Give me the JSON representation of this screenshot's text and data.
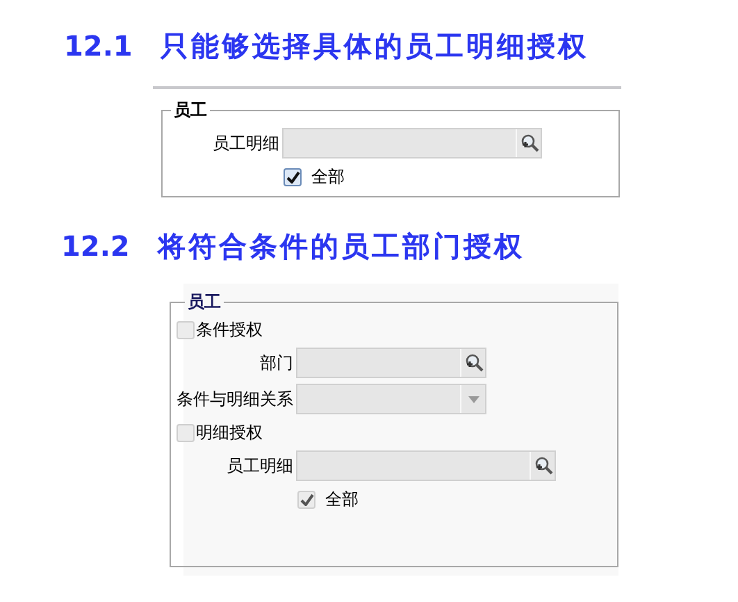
{
  "sections": [
    {
      "number": "12.1",
      "title": "只能够选择具体的员工明细授权",
      "panel": {
        "legend": "员工",
        "rows": [
          {
            "kind": "lookup_field",
            "label": "员工明细",
            "wide": true
          },
          {
            "kind": "checkbox",
            "label": "全部",
            "checked": true,
            "disabled": false
          }
        ]
      }
    },
    {
      "number": "12.2",
      "title": "将符合条件的员工部门授权",
      "panel": {
        "legend": "员工",
        "rows": [
          {
            "kind": "group_checkbox",
            "label": "条件授权",
            "checked": false,
            "disabled": true
          },
          {
            "kind": "lookup_field",
            "label": "部门",
            "wide": false
          },
          {
            "kind": "dropdown_field",
            "label": "条件与明细关系",
            "wide": false
          },
          {
            "kind": "group_checkbox",
            "label": "明细授权",
            "checked": false,
            "disabled": true
          },
          {
            "kind": "lookup_field",
            "label": "员工明细",
            "wide": true
          },
          {
            "kind": "checkbox",
            "label": "全部",
            "checked": true,
            "disabled": true
          }
        ]
      }
    }
  ]
}
